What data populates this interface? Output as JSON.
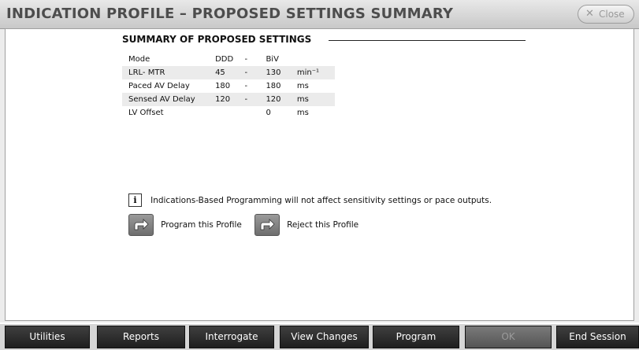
{
  "window": {
    "title": "INDICATION PROFILE – PROPOSED SETTINGS SUMMARY",
    "close_label": "Close",
    "close_icon": "x"
  },
  "summary": {
    "heading": "SUMMARY OF PROPOSED SETTINGS",
    "columns": [
      "Mode",
      "DDD",
      "-",
      "BiV",
      ""
    ],
    "rows": [
      {
        "name": "LRL- MTR",
        "ddd": "45",
        "dash": "-",
        "biv": "130",
        "unit": "min⁻¹"
      },
      {
        "name": "Paced AV Delay",
        "ddd": "180",
        "dash": "-",
        "biv": "180",
        "unit": "ms"
      },
      {
        "name": "Sensed AV Delay",
        "ddd": "120",
        "dash": "-",
        "biv": "120",
        "unit": "ms"
      },
      {
        "name": "LV Offset",
        "ddd": "",
        "dash": "",
        "biv": "0",
        "unit": "ms"
      }
    ]
  },
  "info": {
    "icon": "info-icon",
    "text": "Indications-Based Programming will not affect sensitivity settings or pace outputs."
  },
  "actions": {
    "program_label": "Program this Profile",
    "reject_label": "Reject this Profile"
  },
  "toolbar": {
    "utilities": "Utilities",
    "reports": "Reports",
    "interrogate": "Interrogate",
    "view_changes": "View Changes",
    "program": "Program",
    "ok": "OK",
    "end_session": "End Session"
  }
}
